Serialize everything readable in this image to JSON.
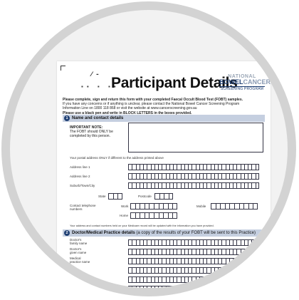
{
  "form": {
    "title": "Participant Details",
    "barcode_glyph": "⁄ ⁃",
    "corner_marks": "▪▪  ▪ ▪▪",
    "logo": {
      "line1": "NATIONAL",
      "line2a": "BOWEL",
      "line2b": "CANCER",
      "line3": "SCREENING PROGRAM"
    },
    "intro": {
      "line1": "Please complete, sign and return this form with your completed Faecal Occult Blood Test (FOBT) samples.",
      "line2": "If you have any concerns or if anything is unclear, please contact the National Bowel Cancer Screening Program",
      "line3": "Information Line on 1800 118 868 or visit the website at www.cancerscreening.gov.au",
      "line4": "Please use a black pen and write in BLOCK LETTERS in the boxes provided."
    },
    "section1": {
      "number": "1",
      "title": "Name and contact details",
      "note_title": "IMPORTANT NOTE:",
      "note_body": "The FOBT should ONLY be completed by this person.",
      "postal_hint": "Your postal address ONLY if different to the address printed above",
      "address1": "Address line 1",
      "address2": "Address line 2",
      "suburb": "Suburb/Town/City",
      "state": "State",
      "postcode": "Postcode",
      "contact": "Contact telephone numbers",
      "work": "Work",
      "mobile": "Mobile",
      "home": "Home",
      "footer": "Your address and contact numbers held on your Medicare record will be updated with the information you have provided."
    },
    "section2": {
      "number": "2",
      "title": "Doctor/Medical Practice details",
      "subtitle": "(a copy of the results of your FOBT will be sent to this Practice)",
      "family_name": "Doctor's family name",
      "given_name": "Doctor's given name",
      "practice_name": "Medical practice name"
    }
  }
}
